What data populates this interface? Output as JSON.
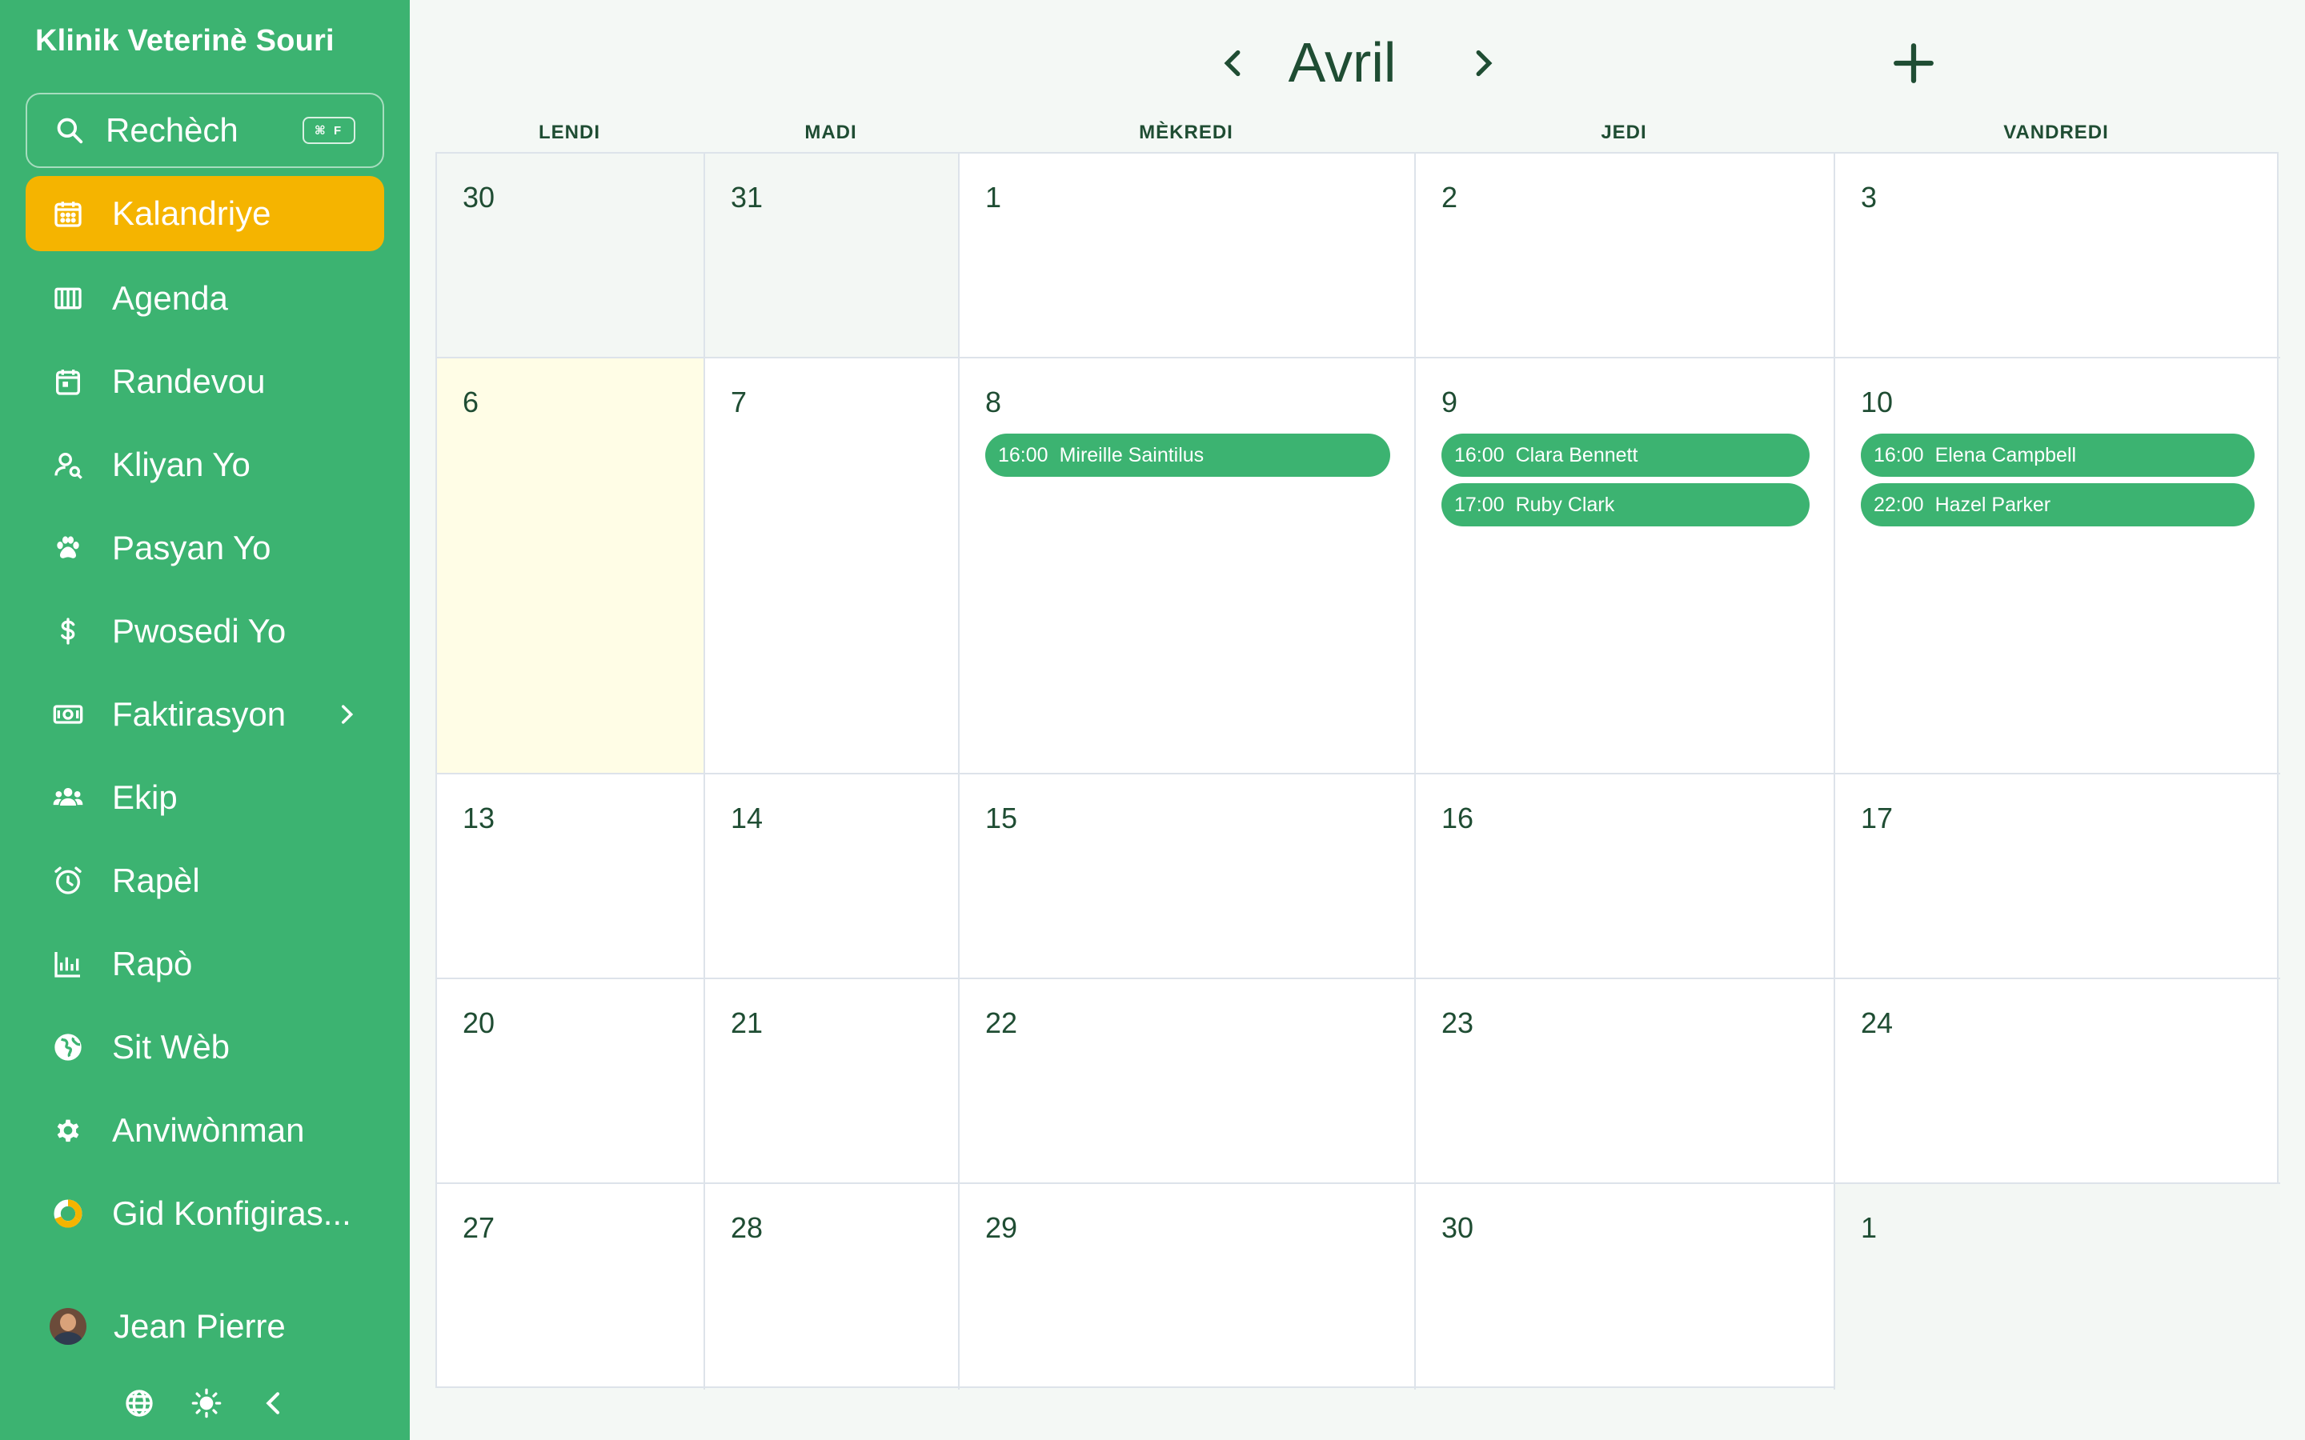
{
  "sidebar": {
    "brand": "Klinik Veterinè Souri",
    "search": {
      "label": "Rechèch",
      "shortcut": "⌘ F"
    },
    "items": [
      {
        "label": "Kalandriye",
        "icon": "calendar-grid-icon",
        "active": true
      },
      {
        "label": "Agenda",
        "icon": "columns-icon"
      },
      {
        "label": "Randevou",
        "icon": "calendar-day-icon"
      },
      {
        "label": "Kliyan Yo",
        "icon": "user-search-icon"
      },
      {
        "label": "Pasyan Yo",
        "icon": "paw-icon"
      },
      {
        "label": "Pwosedi Yo",
        "icon": "dollar-icon"
      },
      {
        "label": "Faktirasyon",
        "icon": "cash-icon",
        "has_submenu": true
      },
      {
        "label": "Ekip",
        "icon": "team-icon"
      },
      {
        "label": "Rapèl",
        "icon": "alarm-icon"
      },
      {
        "label": "Rapò",
        "icon": "bar-chart-icon"
      },
      {
        "label": "Sit Wèb",
        "icon": "globe-icon"
      },
      {
        "label": "Anviwònman",
        "icon": "gear-icon"
      },
      {
        "label": "Gid Konfigiras...",
        "icon": "progress-ring-icon"
      }
    ],
    "user": {
      "name": "Jean Pierre"
    },
    "footer_icons": [
      "language-globe-icon",
      "sun-icon",
      "collapse-chevron-icon"
    ]
  },
  "calendar": {
    "month": "Avril",
    "weekdays": [
      "LENDI",
      "MADI",
      "MÈKREDI",
      "JEDI",
      "VANDREDI"
    ],
    "weeks": [
      [
        {
          "day": "30",
          "muted": true
        },
        {
          "day": "31",
          "muted": true
        },
        {
          "day": "1"
        },
        {
          "day": "2"
        },
        {
          "day": "3"
        }
      ],
      [
        {
          "day": "6",
          "today": true
        },
        {
          "day": "7"
        },
        {
          "day": "8",
          "events": [
            {
              "time": "16:00",
              "name": "Mireille Saintilus"
            }
          ]
        },
        {
          "day": "9",
          "events": [
            {
              "time": "16:00",
              "name": "Clara Bennett"
            },
            {
              "time": "17:00",
              "name": "Ruby Clark"
            }
          ]
        },
        {
          "day": "10",
          "events": [
            {
              "time": "16:00",
              "name": "Elena Campbell"
            },
            {
              "time": "22:00",
              "name": "Hazel Parker"
            }
          ]
        }
      ],
      [
        {
          "day": "13"
        },
        {
          "day": "14"
        },
        {
          "day": "15"
        },
        {
          "day": "16"
        },
        {
          "day": "17"
        }
      ],
      [
        {
          "day": "20"
        },
        {
          "day": "21"
        },
        {
          "day": "22"
        },
        {
          "day": "23"
        },
        {
          "day": "24"
        }
      ],
      [
        {
          "day": "27"
        },
        {
          "day": "28"
        },
        {
          "day": "29"
        },
        {
          "day": "30"
        },
        {
          "day": "1",
          "muted": true
        }
      ]
    ]
  },
  "colors": {
    "primary": "#3cb371",
    "accent": "#f5b400",
    "text": "#1f4d33",
    "today": "#fffde6"
  }
}
